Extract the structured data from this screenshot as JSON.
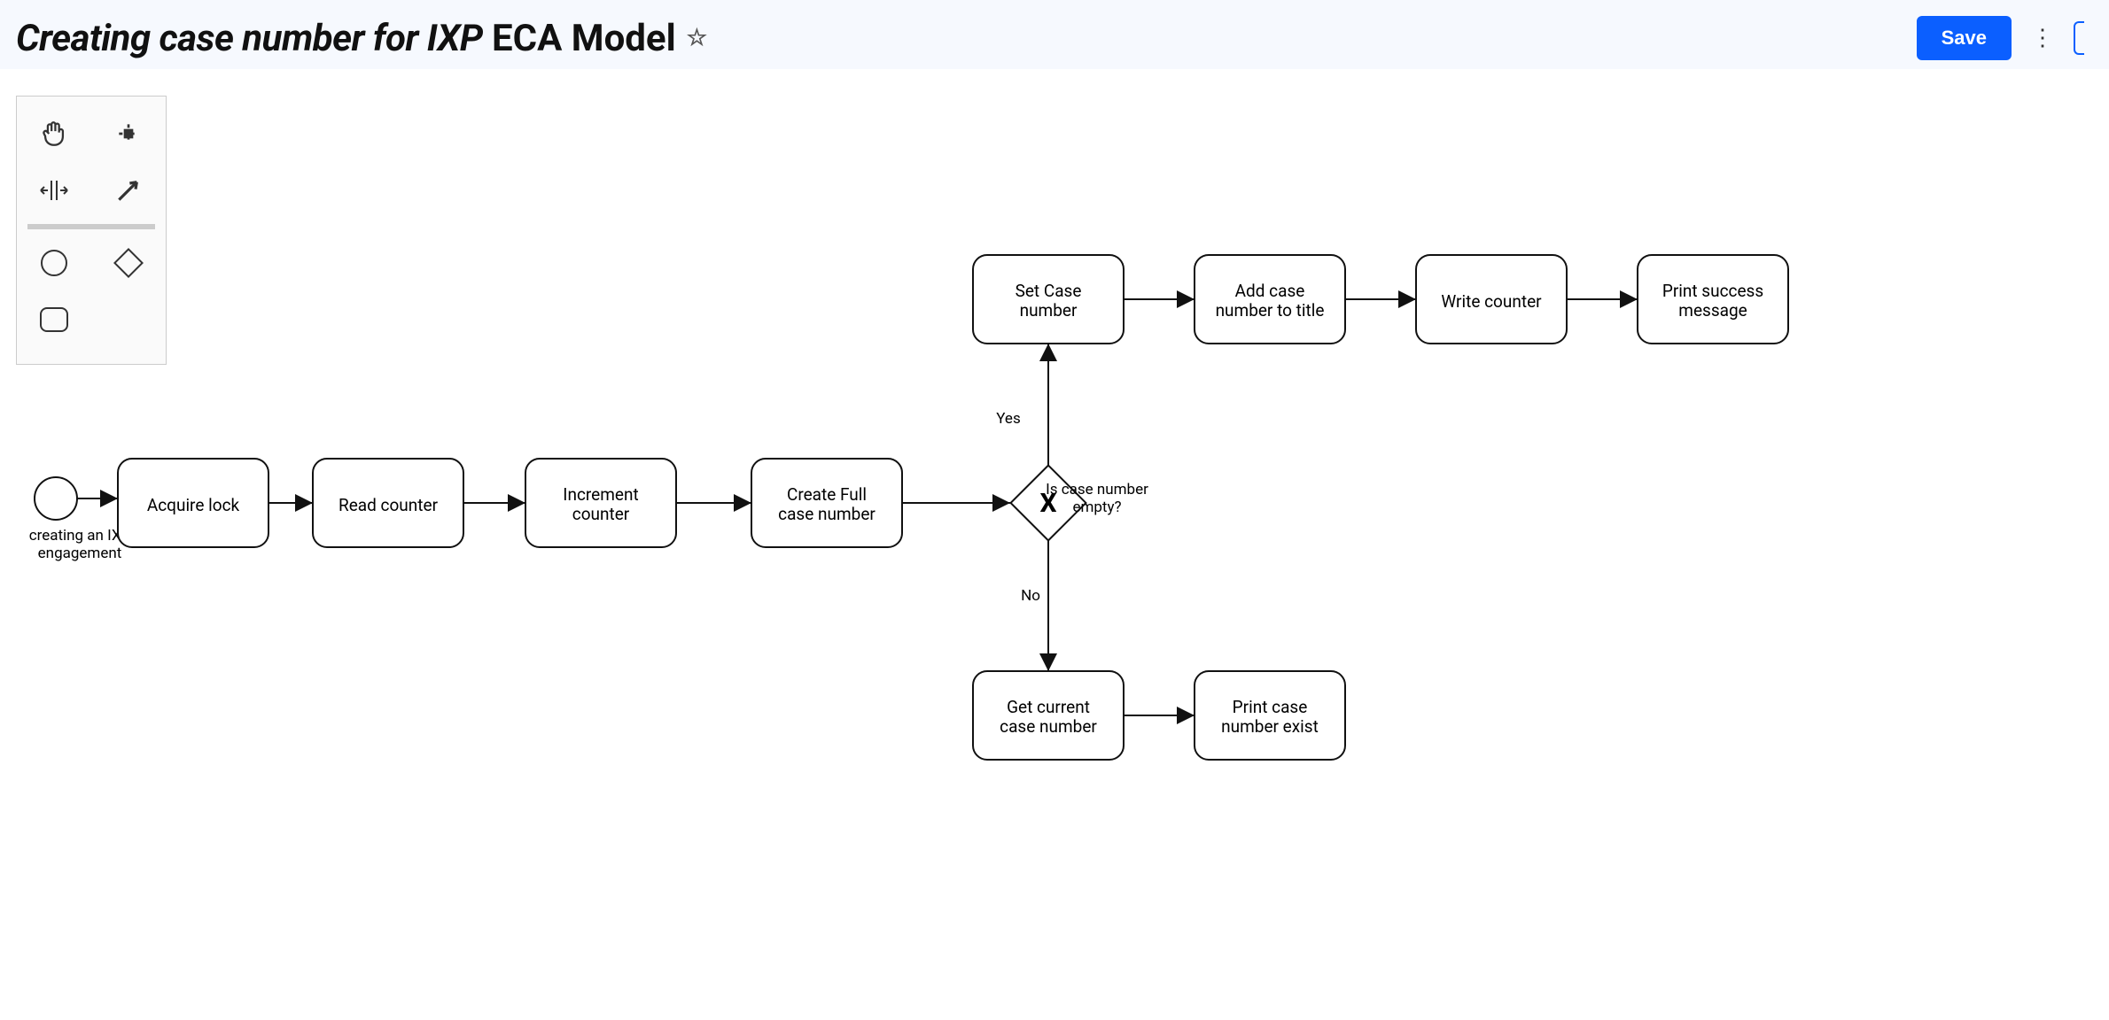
{
  "header": {
    "title_italic": "Creating case number for IXP",
    "title_rest": " ECA Model",
    "save_label": "Save"
  },
  "palette_icons": [
    "hand",
    "selection",
    "align-center",
    "arrow",
    "circle",
    "diamond",
    "rounded-rect"
  ],
  "diagram": {
    "start_event_label": "creating an IXP\nengagement",
    "gateway_label": "Is case number\nempty?",
    "edge_yes": "Yes",
    "edge_no": "No",
    "tasks": {
      "acquire_lock": "Acquire lock",
      "read_counter": "Read counter",
      "increment_counter": "Increment\ncounter",
      "create_full": "Create Full\ncase number",
      "set_case": "Set Case\nnumber",
      "add_case_title": "Add case\nnumber to title",
      "write_counter": "Write counter",
      "print_success": "Print success\nmessage",
      "get_current": "Get current\ncase number",
      "print_exist": "Print case\nnumber exist"
    }
  },
  "chart_data": {
    "type": "bpmn-flowchart",
    "nodes": [
      {
        "id": "start",
        "type": "start-event",
        "label": "creating an IXP engagement"
      },
      {
        "id": "t1",
        "type": "task",
        "label": "Acquire lock"
      },
      {
        "id": "t2",
        "type": "task",
        "label": "Read counter"
      },
      {
        "id": "t3",
        "type": "task",
        "label": "Increment counter"
      },
      {
        "id": "t4",
        "type": "task",
        "label": "Create Full case number"
      },
      {
        "id": "g1",
        "type": "exclusive-gateway",
        "label": "Is case number empty?"
      },
      {
        "id": "t5",
        "type": "task",
        "label": "Set Case number"
      },
      {
        "id": "t6",
        "type": "task",
        "label": "Add case number to title"
      },
      {
        "id": "t7",
        "type": "task",
        "label": "Write counter"
      },
      {
        "id": "t8",
        "type": "task",
        "label": "Print success message"
      },
      {
        "id": "t9",
        "type": "task",
        "label": "Get current case number"
      },
      {
        "id": "t10",
        "type": "task",
        "label": "Print case number exist"
      }
    ],
    "edges": [
      {
        "from": "start",
        "to": "t1"
      },
      {
        "from": "t1",
        "to": "t2"
      },
      {
        "from": "t2",
        "to": "t3"
      },
      {
        "from": "t3",
        "to": "t4"
      },
      {
        "from": "t4",
        "to": "g1"
      },
      {
        "from": "g1",
        "to": "t5",
        "label": "Yes"
      },
      {
        "from": "t5",
        "to": "t6"
      },
      {
        "from": "t6",
        "to": "t7"
      },
      {
        "from": "t7",
        "to": "t8"
      },
      {
        "from": "g1",
        "to": "t9",
        "label": "No"
      },
      {
        "from": "t9",
        "to": "t10"
      }
    ]
  }
}
